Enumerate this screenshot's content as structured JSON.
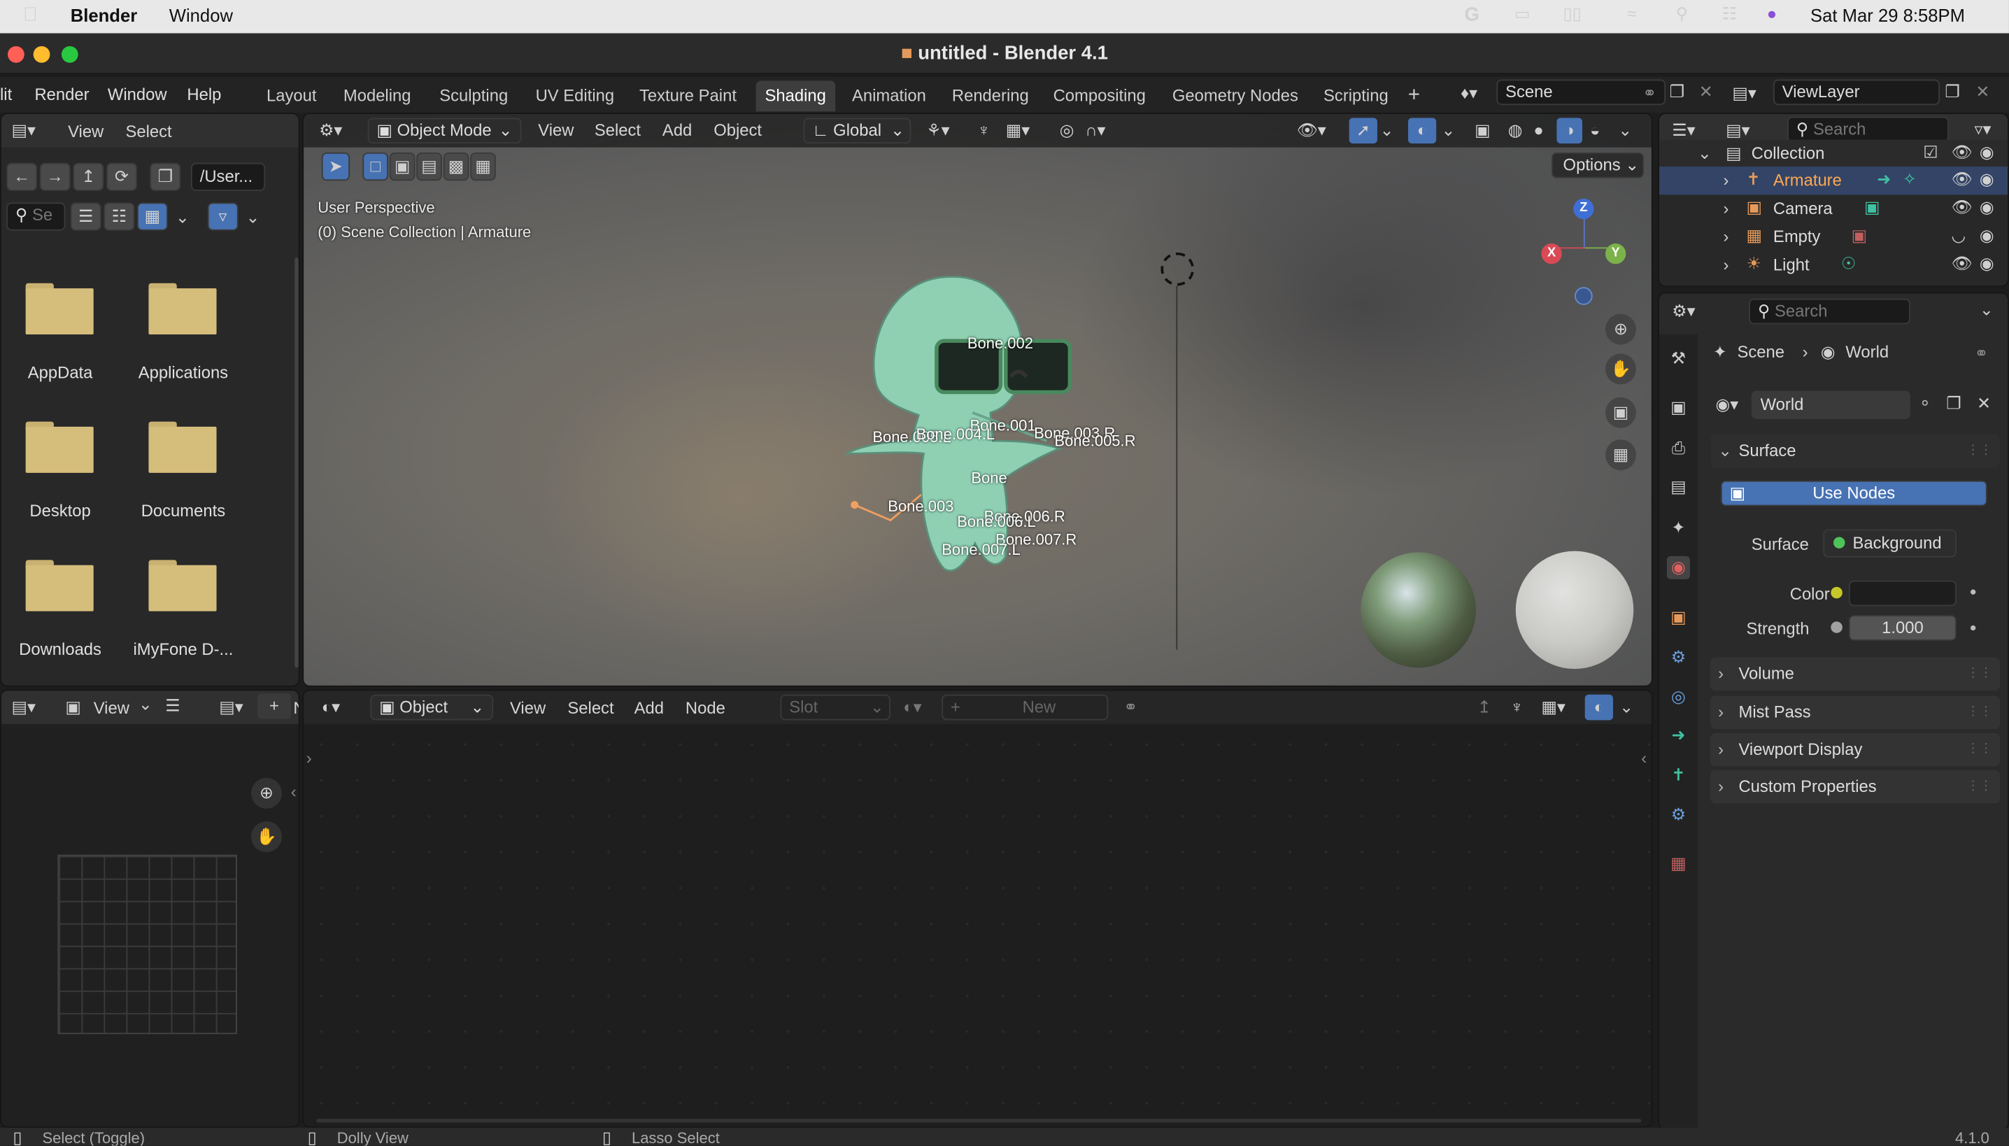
{
  "mac_menubar": {
    "app_name": "Blender",
    "menu_window": "Window",
    "clock": "Sat Mar 29  8:58PM"
  },
  "window": {
    "title": "untitled - Blender 4.1"
  },
  "topbar": {
    "menus": [
      "lit",
      "Render",
      "Window",
      "Help"
    ],
    "workspaces": [
      "Layout",
      "Modeling",
      "Sculpting",
      "UV Editing",
      "Texture Paint",
      "Shading",
      "Animation",
      "Rendering",
      "Compositing",
      "Geometry Nodes",
      "Scripting"
    ],
    "active_workspace": "Shading",
    "add_tab": "+",
    "scene": "Scene",
    "view_layer": "ViewLayer"
  },
  "file_browser": {
    "menus": [
      "View",
      "Select"
    ],
    "path": "/User...",
    "search_placeholder": "Se",
    "folders": [
      "AppData",
      "Applications",
      "Desktop",
      "Documents",
      "Downloads",
      "iMyFone D-..."
    ]
  },
  "viewport": {
    "mode": "Object Mode",
    "menus": [
      "View",
      "Select",
      "Add",
      "Object"
    ],
    "transform": "Global",
    "options": "Options",
    "overlay_line1": "User Perspective",
    "overlay_line2": "(0) Scene Collection | Armature",
    "bones": [
      "Bone.002",
      "Bone.001",
      "Bone.003.R",
      "Bone.005.R",
      "Bone.005.L",
      "Bone.004.L",
      "Bone",
      "Bone.003",
      "Bone.006.R",
      "Bone.006.L",
      "Bone.007.R",
      "Bone.007.L"
    ],
    "gizmo": {
      "x": "X",
      "y": "Y",
      "z": "Z"
    }
  },
  "image_editor": {
    "view": "View",
    "n_label": "N"
  },
  "node_editor": {
    "type": "Object",
    "menus": [
      "View",
      "Select",
      "Add",
      "Node"
    ],
    "slot": "Slot",
    "new": "New"
  },
  "outliner": {
    "search_placeholder": "Search",
    "collection": "Collection",
    "items": [
      {
        "name": "Armature",
        "color": "#e59a5a"
      },
      {
        "name": "Camera",
        "color": "#e59a5a"
      },
      {
        "name": "Empty",
        "color": "#e59a5a"
      },
      {
        "name": "Light",
        "color": "#e59a5a"
      }
    ]
  },
  "properties": {
    "search_placeholder": "Search",
    "breadcrumb_scene": "Scene",
    "breadcrumb_world": "World",
    "world_name": "World",
    "surface_section": "Surface",
    "use_nodes": "Use Nodes",
    "surface_label": "Surface",
    "surface_value": "Background",
    "color_label": "Color",
    "strength_label": "Strength",
    "strength_value": "1.000",
    "sections": [
      "Volume",
      "Mist Pass",
      "Viewport Display",
      "Custom Properties"
    ]
  },
  "status_bar": {
    "items": [
      "Select (Toggle)",
      "Dolly View",
      "Lasso Select"
    ],
    "version": "4.1.0"
  },
  "colors": {
    "accent": "#4772b3",
    "selection_row": "#334466",
    "active_object": "#ffa851"
  }
}
